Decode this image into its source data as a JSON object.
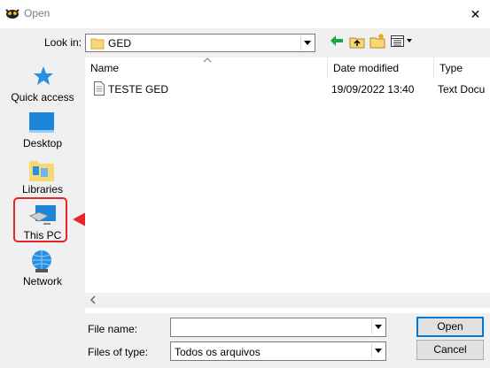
{
  "window": {
    "title": "Open",
    "close_glyph": "✕"
  },
  "lookin": {
    "label": "Look in:",
    "value": "GED"
  },
  "places": [
    {
      "label": "Quick access",
      "icon": "star-icon"
    },
    {
      "label": "Desktop",
      "icon": "desktop-icon"
    },
    {
      "label": "Libraries",
      "icon": "libraries-icon"
    },
    {
      "label": "This PC",
      "icon": "computer-icon"
    },
    {
      "label": "Network",
      "icon": "network-icon"
    }
  ],
  "columns": {
    "name": "Name",
    "date": "Date modified",
    "type": "Type"
  },
  "files": [
    {
      "name": "TESTE GED",
      "date": "19/09/2022 13:40",
      "type": "Text Docu"
    }
  ],
  "bottom": {
    "filename_label": "File name:",
    "filename_value": "",
    "filetype_label": "Files of type:",
    "filetype_value": "Todos os arquivos",
    "open_label": "Open",
    "cancel_label": "Cancel"
  },
  "colors": {
    "highlight": "#e8232a",
    "accent": "#0078d7"
  }
}
